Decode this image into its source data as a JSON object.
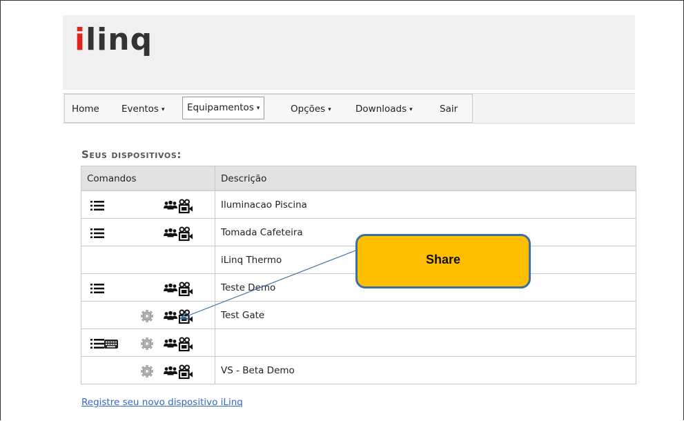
{
  "logo": {
    "i": "i",
    "rest": "linq"
  },
  "nav": {
    "items": [
      {
        "label": "Home",
        "caret": ""
      },
      {
        "label": "Eventos",
        "caret": "▾"
      },
      {
        "label": "Equipamentos",
        "caret": "▾"
      },
      {
        "label": "Opções",
        "caret": "▾"
      },
      {
        "label": "Downloads",
        "caret": "▾"
      },
      {
        "label": "Sair",
        "caret": ""
      }
    ],
    "active_index": 2
  },
  "section_title": "Seus dispositivos:",
  "table": {
    "headers": [
      "Comandos",
      "Descrição"
    ],
    "rows": [
      {
        "description": "Iluminacao Piscina",
        "icons": [
          "list-icon",
          "group-icon",
          "video-icon"
        ]
      },
      {
        "description": "Tomada Cafeteira",
        "icons": [
          "list-icon",
          "group-icon",
          "video-icon"
        ]
      },
      {
        "description": "iLinq Thermo",
        "icons": []
      },
      {
        "description": "Teste Demo",
        "icons": [
          "list-icon",
          "group-icon",
          "video-icon"
        ]
      },
      {
        "description": "Test Gate",
        "icons": [
          "gear-icon",
          "group-icon",
          "video-icon"
        ]
      },
      {
        "description": "",
        "icons": [
          "list-icon",
          "keyboard-icon",
          "gear-icon",
          "group-icon",
          "video-icon"
        ]
      },
      {
        "description": "VS - Beta Demo",
        "icons": [
          "gear-icon",
          "group-icon",
          "video-icon"
        ]
      }
    ]
  },
  "register_link": "Registre seu novo dispositivo iLinq",
  "callout": {
    "label": "Share"
  },
  "colors": {
    "accent_red": "#e2231a",
    "callout_fill": "#ffbf00",
    "callout_border": "#3a6fa8",
    "link": "#3366cc"
  }
}
